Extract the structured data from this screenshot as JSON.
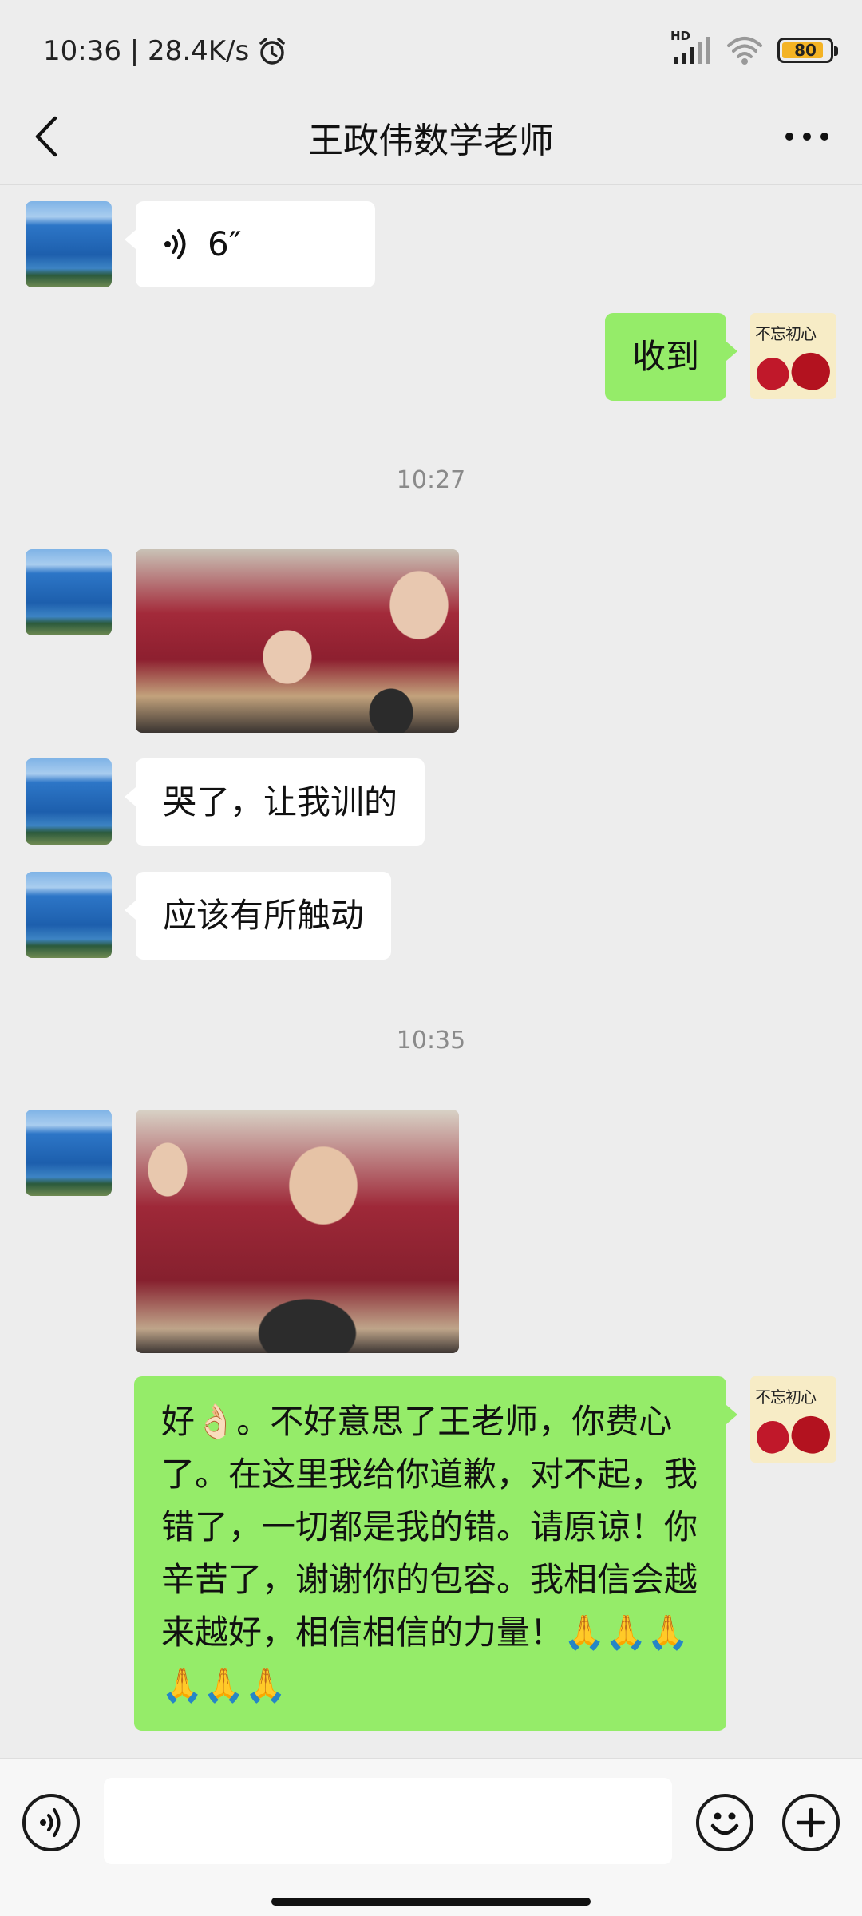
{
  "status_bar": {
    "time_speed": "10:36 | 28.4K/s",
    "network": "HD",
    "battery": "80",
    "icons": [
      "alarm-icon",
      "signal-icon",
      "wifi-icon",
      "battery-icon"
    ]
  },
  "header": {
    "title": "王政伟数学老师",
    "back_icon": "back-chevron-icon",
    "more_icon": "more-dots-icon"
  },
  "messages": [
    {
      "type": "voice",
      "side": "left",
      "duration": "6″"
    },
    {
      "type": "text",
      "side": "right",
      "text": "收到"
    },
    {
      "type": "timestamp",
      "text": "10:27"
    },
    {
      "type": "image",
      "side": "left",
      "description": "photo"
    },
    {
      "type": "text",
      "side": "left",
      "text": "哭了，让我训的"
    },
    {
      "type": "text",
      "side": "left",
      "text": "应该有所触动"
    },
    {
      "type": "timestamp",
      "text": "10:35"
    },
    {
      "type": "image",
      "side": "left",
      "description": "photo"
    },
    {
      "type": "text",
      "side": "right",
      "text": "好👌🏻。不好意思了王老师，你费心了。在这里我给你道歉，对不起，我错了，一切都是我的错。请原谅！你辛苦了，谢谢你的包容。我相信会越来越好，相信相信的力量！🙏🙏🙏🙏🙏🙏"
    }
  ],
  "avatars": {
    "self_text": "不忘初心"
  },
  "input_bar": {
    "placeholder": "",
    "icons": [
      "voice-toggle-icon",
      "emoji-icon",
      "plus-icon"
    ]
  },
  "colors": {
    "background": "#ededed",
    "self_bubble": "#95ec69",
    "other_bubble": "#ffffff",
    "timestamp": "#8a8a8a"
  }
}
